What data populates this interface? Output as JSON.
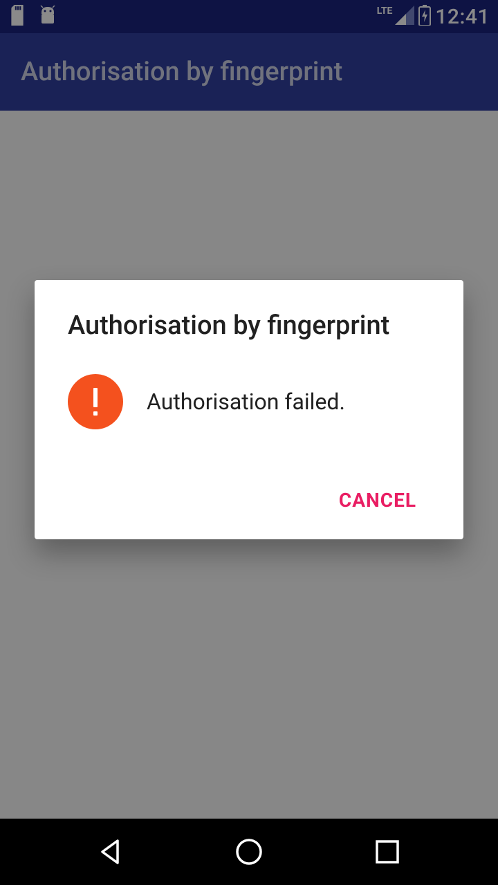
{
  "statusbar": {
    "time": "12:41",
    "lte_label": "LTE"
  },
  "appbar": {
    "title": "Authorisation by fingerprint"
  },
  "dialog": {
    "title": "Authorisation by fingerprint",
    "message": "Authorisation failed.",
    "cancel_label": "CANCEL"
  },
  "colors": {
    "primary_dark": "#1a237e",
    "primary": "#303f9f",
    "accent": "#e91e63",
    "error": "#f4511e"
  }
}
